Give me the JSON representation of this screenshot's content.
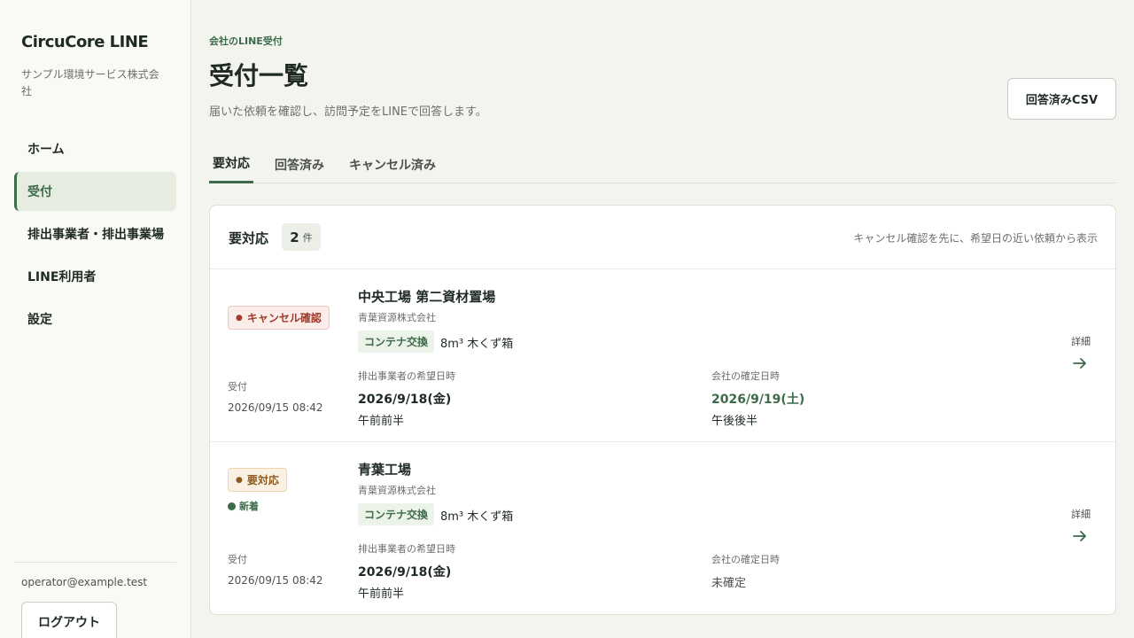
{
  "sidebar": {
    "brand": "CircuCore LINE",
    "company": "サンプル環境サービス株式会社",
    "nav": [
      {
        "label": "ホーム",
        "active": false
      },
      {
        "label": "受付",
        "active": true
      },
      {
        "label": "排出事業者・排出事業場",
        "active": false
      },
      {
        "label": "LINE利用者",
        "active": false
      },
      {
        "label": "設定",
        "active": false
      }
    ],
    "user_email": "operator@example.test",
    "logout_label": "ログアウト"
  },
  "header": {
    "eyebrow": "会社のLINE受付",
    "title": "受付一覧",
    "description": "届いた依頼を確認し、訪問予定をLINEで回答します。",
    "csv_button": "回答済みCSV"
  },
  "tabs": [
    {
      "label": "要対応",
      "active": true
    },
    {
      "label": "回答済み",
      "active": false
    },
    {
      "label": "キャンセル済み",
      "active": false
    }
  ],
  "panel": {
    "title": "要対応",
    "count": "2",
    "count_unit": "件",
    "note": "キャンセル確認を先に、希望日の近い依頼から表示"
  },
  "requests": [
    {
      "status": "キャンセル確認",
      "status_type": "cancel",
      "new_label": "",
      "received_label": "受付",
      "received_at": "2026/09/15 08:42",
      "site": "中央工場 第二資材置場",
      "org": "青葉資源株式会社",
      "service": "コンテナ交換",
      "container": "8m³ 木くず箱",
      "requested_label": "排出事業者の希望日時",
      "requested_date": "2026/9/18(金)",
      "requested_slot": "午前前半",
      "confirmed_label": "会社の確定日時",
      "confirmed_date": "2026/9/19(土)",
      "confirmed_slot": "午後後半",
      "detail_label": "詳細"
    },
    {
      "status": "要対応",
      "status_type": "todo",
      "new_label": "新着",
      "received_label": "受付",
      "received_at": "2026/09/15 08:42",
      "site": "青葉工場",
      "org": "青葉資源株式会社",
      "service": "コンテナ交換",
      "container": "8m³ 木くず箱",
      "requested_label": "排出事業者の希望日時",
      "requested_date": "2026/9/18(金)",
      "requested_slot": "午前前半",
      "confirmed_label": "会社の確定日時",
      "confirmed_text": "未確定",
      "detail_label": "詳細"
    }
  ],
  "colors": {
    "accent": "#3d6b4a",
    "active_nav_bg": "#e6ede0",
    "cancel_badge": "#a13a2a",
    "todo_badge": "#8b5a1f"
  }
}
